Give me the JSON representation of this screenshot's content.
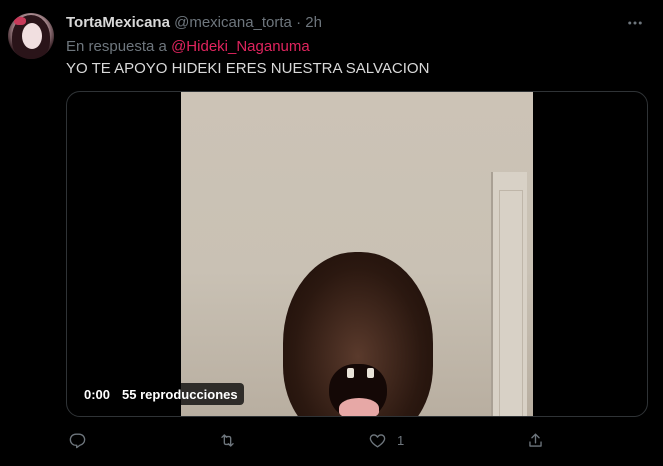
{
  "tweet": {
    "display_name": "TortaMexicana",
    "handle": "@mexicana_torta",
    "separator": "·",
    "time": "2h",
    "reply_prefix": "En respuesta a",
    "reply_to": "@Hideki_Naganuma",
    "text": "YO TE APOYO HIDEKI ERES NUESTRA SALVACION"
  },
  "video": {
    "timestamp": "0:00",
    "views": "55 reproducciones"
  },
  "actions": {
    "reply_count": "",
    "retweet_count": "",
    "like_count": "1",
    "share_count": ""
  },
  "icons": {
    "more": "more-horizontal-icon",
    "reply": "comment-icon",
    "retweet": "retweet-icon",
    "like": "heart-icon",
    "share": "share-icon"
  },
  "colors": {
    "background": "#000000",
    "text": "#d9d9d9",
    "secondary": "#6e767d",
    "mention": "#e0245e",
    "border": "#2f3336"
  }
}
